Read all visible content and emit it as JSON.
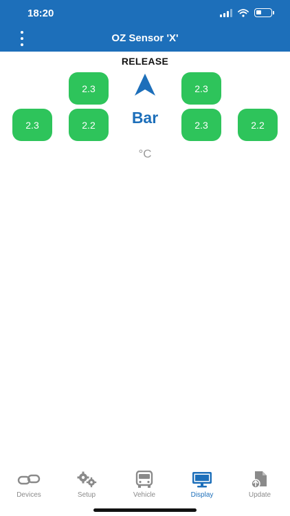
{
  "status_bar": {
    "time": "18:20"
  },
  "header": {
    "title": "OZ Sensor 'X'"
  },
  "display": {
    "mode": "RELEASE",
    "pressure_unit": "Bar",
    "temperature_unit": "°C",
    "tires": {
      "front_left": "2.3",
      "front_right": "2.3",
      "rear_outer_left": "2.3",
      "rear_inner_left": "2.2",
      "rear_inner_right": "2.3",
      "rear_outer_right": "2.2"
    }
  },
  "tabs": [
    {
      "label": "Devices",
      "icon": "link-icon"
    },
    {
      "label": "Setup",
      "icon": "gears-icon"
    },
    {
      "label": "Vehicle",
      "icon": "bus-icon"
    },
    {
      "label": "Display",
      "icon": "monitor-icon",
      "active": true
    },
    {
      "label": "Update",
      "icon": "upload-file-icon"
    }
  ],
  "colors": {
    "header": "#1d6fba",
    "tire_ok": "#2ec45b",
    "active_tab": "#1d6fba",
    "inactive_tab": "#8a8a8a"
  }
}
